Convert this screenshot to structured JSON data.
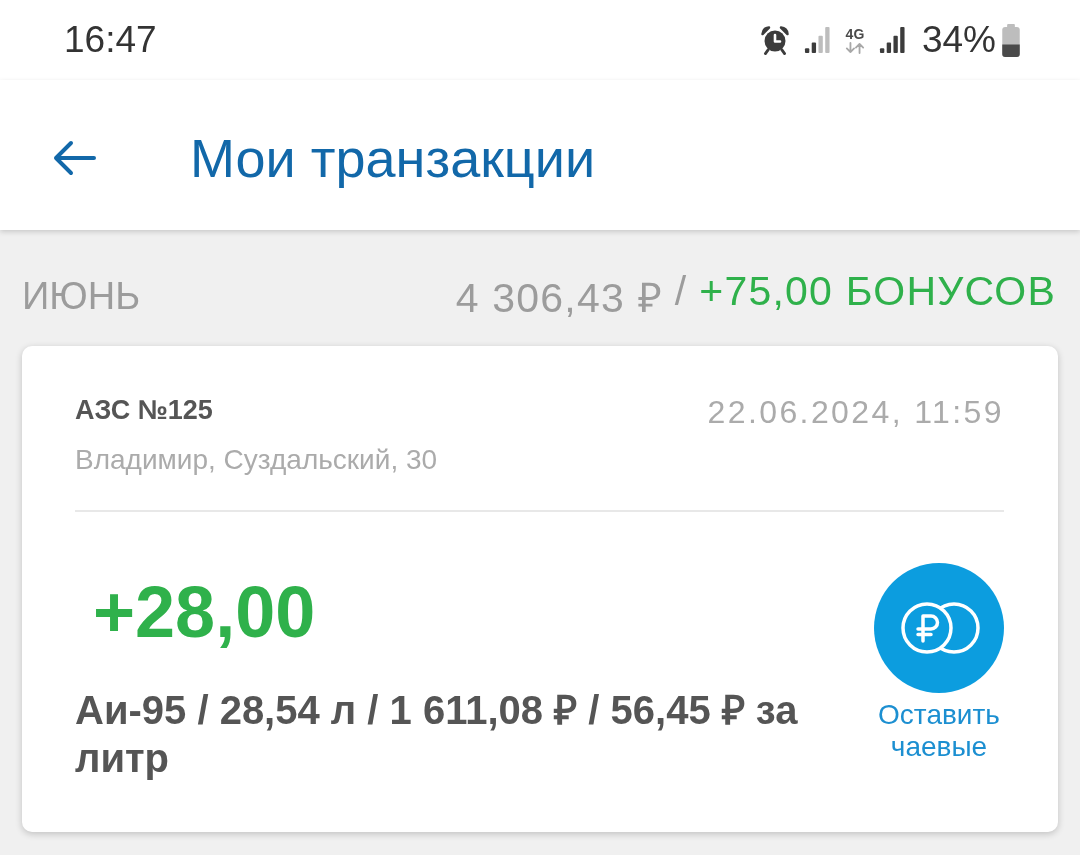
{
  "status_bar": {
    "time": "16:47",
    "network_type": "4G",
    "battery_text": "34%"
  },
  "app_bar": {
    "title": "Мои транзакции"
  },
  "month_summary": {
    "month": "ИЮНЬ",
    "total": "4 306,43 ₽",
    "separator": "/",
    "bonus": "+75,00 БОНУСОВ"
  },
  "transactions": [
    {
      "station": "АЗС №125",
      "address": "Владимир, Суздальский, 30",
      "datetime": "22.06.2024, 11:59",
      "bonus": "+28,00",
      "details": "Аи-95 / 28,54 л / 1 611,08 ₽ / 56,45 ₽ за литр",
      "tip_label": "Оставить чаевые"
    }
  ]
}
